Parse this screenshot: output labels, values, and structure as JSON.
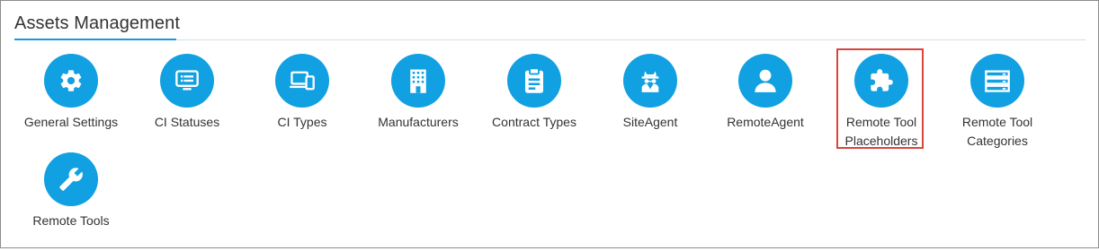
{
  "section": {
    "title": "Assets Management"
  },
  "items": [
    {
      "label": "General Settings",
      "icon": "gear-icon"
    },
    {
      "label": "CI Statuses",
      "icon": "monitor-list-icon"
    },
    {
      "label": "CI Types",
      "icon": "devices-icon"
    },
    {
      "label": "Manufacturers",
      "icon": "building-icon"
    },
    {
      "label": "Contract Types",
      "icon": "clipboard-icon"
    },
    {
      "label": "SiteAgent",
      "icon": "spy-agent-icon"
    },
    {
      "label": "RemoteAgent",
      "icon": "user-icon"
    },
    {
      "label_line1": "Remote Tool",
      "label_line2": "Placeholders",
      "icon": "puzzle-icon",
      "highlighted": true
    },
    {
      "label_line1": "Remote Tool",
      "label_line2": "Categories",
      "icon": "server-rack-icon"
    },
    {
      "label": "Remote Tools",
      "icon": "wrench-icon"
    }
  ],
  "colors": {
    "icon_circle": "#11a0e1",
    "accent": "#1e96d8",
    "highlight_border": "#d9453b"
  }
}
